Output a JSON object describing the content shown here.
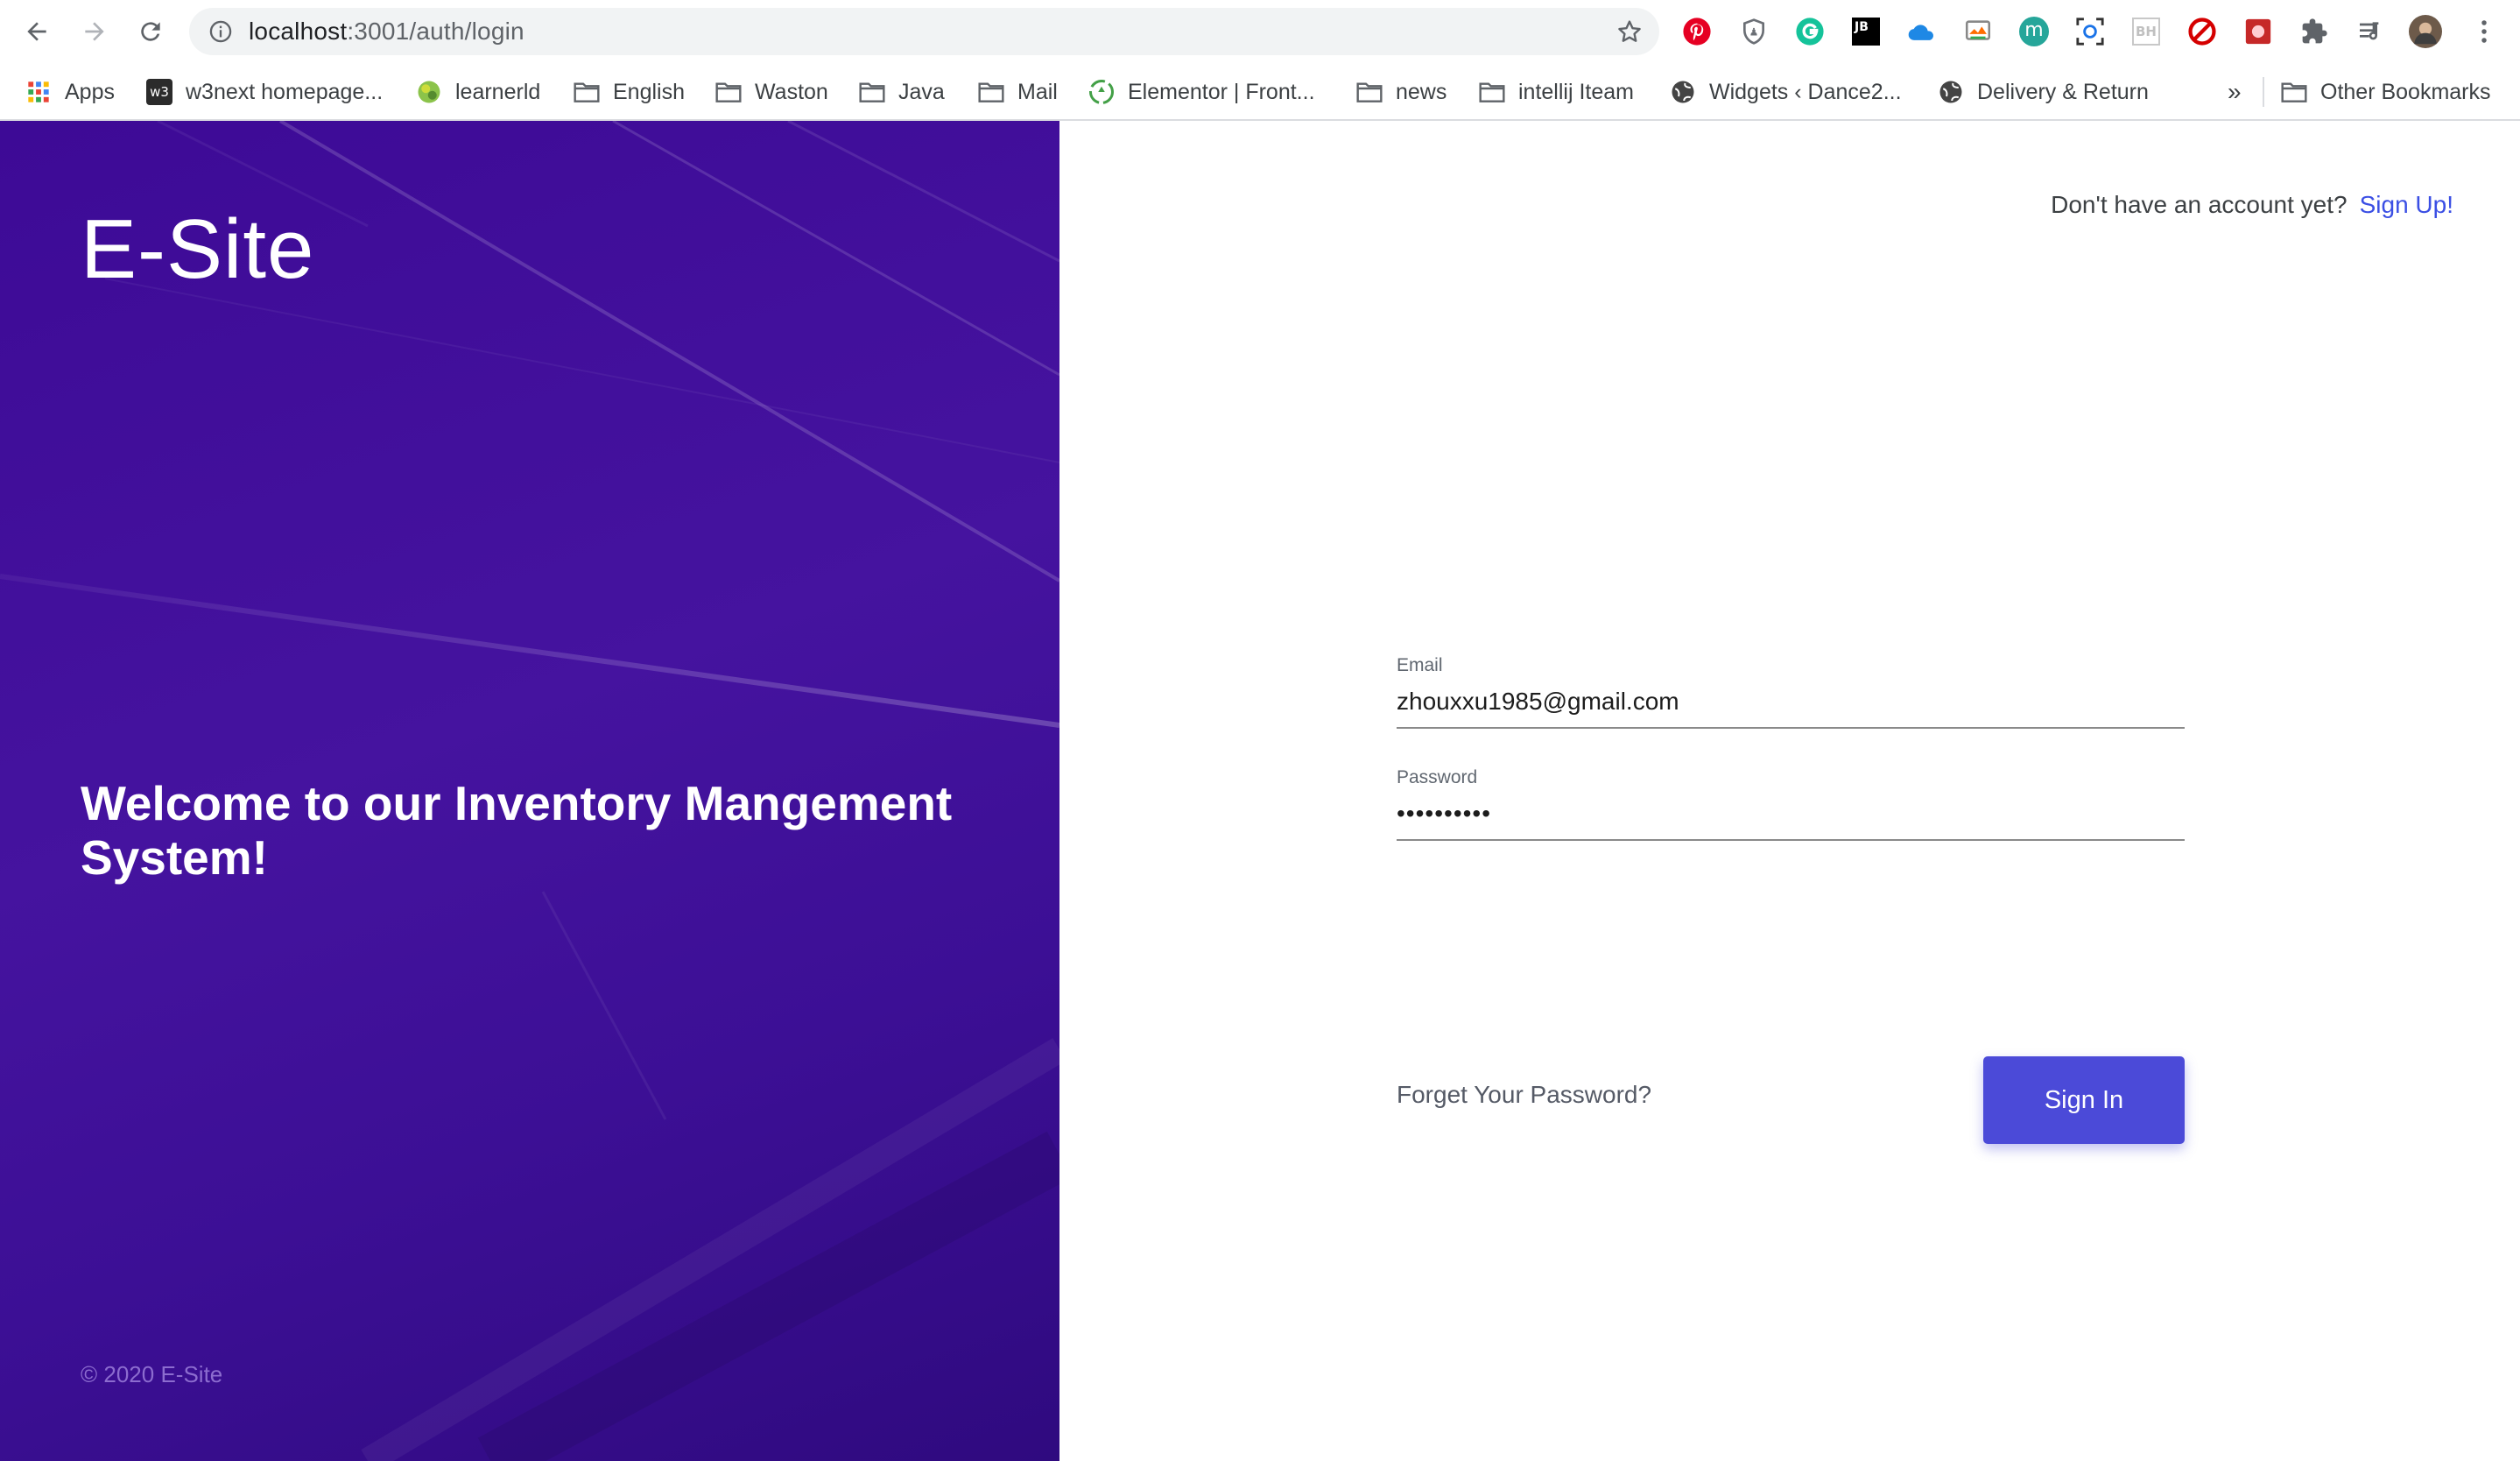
{
  "browser": {
    "url_host": "localhost",
    "url_rest": ":3001/auth/login",
    "bookmarks": [
      {
        "label": "Apps",
        "icon": "apps-grid-icon"
      },
      {
        "label": "w3next homepage...",
        "icon": "w3-icon"
      },
      {
        "label": "learnerld",
        "icon": "globe-icon"
      },
      {
        "label": "English",
        "icon": "folder-icon"
      },
      {
        "label": "Waston",
        "icon": "folder-icon"
      },
      {
        "label": "Java",
        "icon": "folder-icon"
      },
      {
        "label": "Mail",
        "icon": "folder-icon"
      },
      {
        "label": "Elementor | Front...",
        "icon": "recycle-icon"
      },
      {
        "label": "news",
        "icon": "folder-icon"
      },
      {
        "label": "intellij Iteam",
        "icon": "folder-icon"
      },
      {
        "label": "Widgets ‹ Dance2...",
        "icon": "globe-icon"
      },
      {
        "label": "Delivery & Return",
        "icon": "globe-icon"
      }
    ],
    "overflow": "»",
    "other_bookmarks": "Other Bookmarks",
    "extensions": [
      "pinterest-icon",
      "shield-icon",
      "grammarly-icon",
      "jetbrains-icon",
      "cloud-icon",
      "cast-icon",
      "m-extension-icon",
      "scan-icon",
      "bh-icon",
      "block-icon",
      "red-extension-icon",
      "puzzle-icon",
      "reading-list-icon",
      "profile-avatar-icon",
      "menu-kebab-icon"
    ],
    "ext_jb": "JB",
    "ext_m": "m",
    "ext_bh": "BH",
    "w3_badge": "w3"
  },
  "hero": {
    "brand": "E-Site",
    "welcome": "Welcome to our Inventory Mangement System!",
    "copyright": "© 2020 E-Site"
  },
  "auth": {
    "signup_prompt": "Don't have an account yet?",
    "signup_link": "Sign Up!",
    "email_label": "Email",
    "email_value": "zhouxxu1985@gmail.com",
    "password_label": "Password",
    "password_value": "••••••••••",
    "forgot": "Forget Your Password?",
    "signin": "Sign In"
  },
  "colors": {
    "hero_bg": "#3d0a96",
    "accent": "#4b4ad8",
    "link": "#3b4fe4"
  }
}
